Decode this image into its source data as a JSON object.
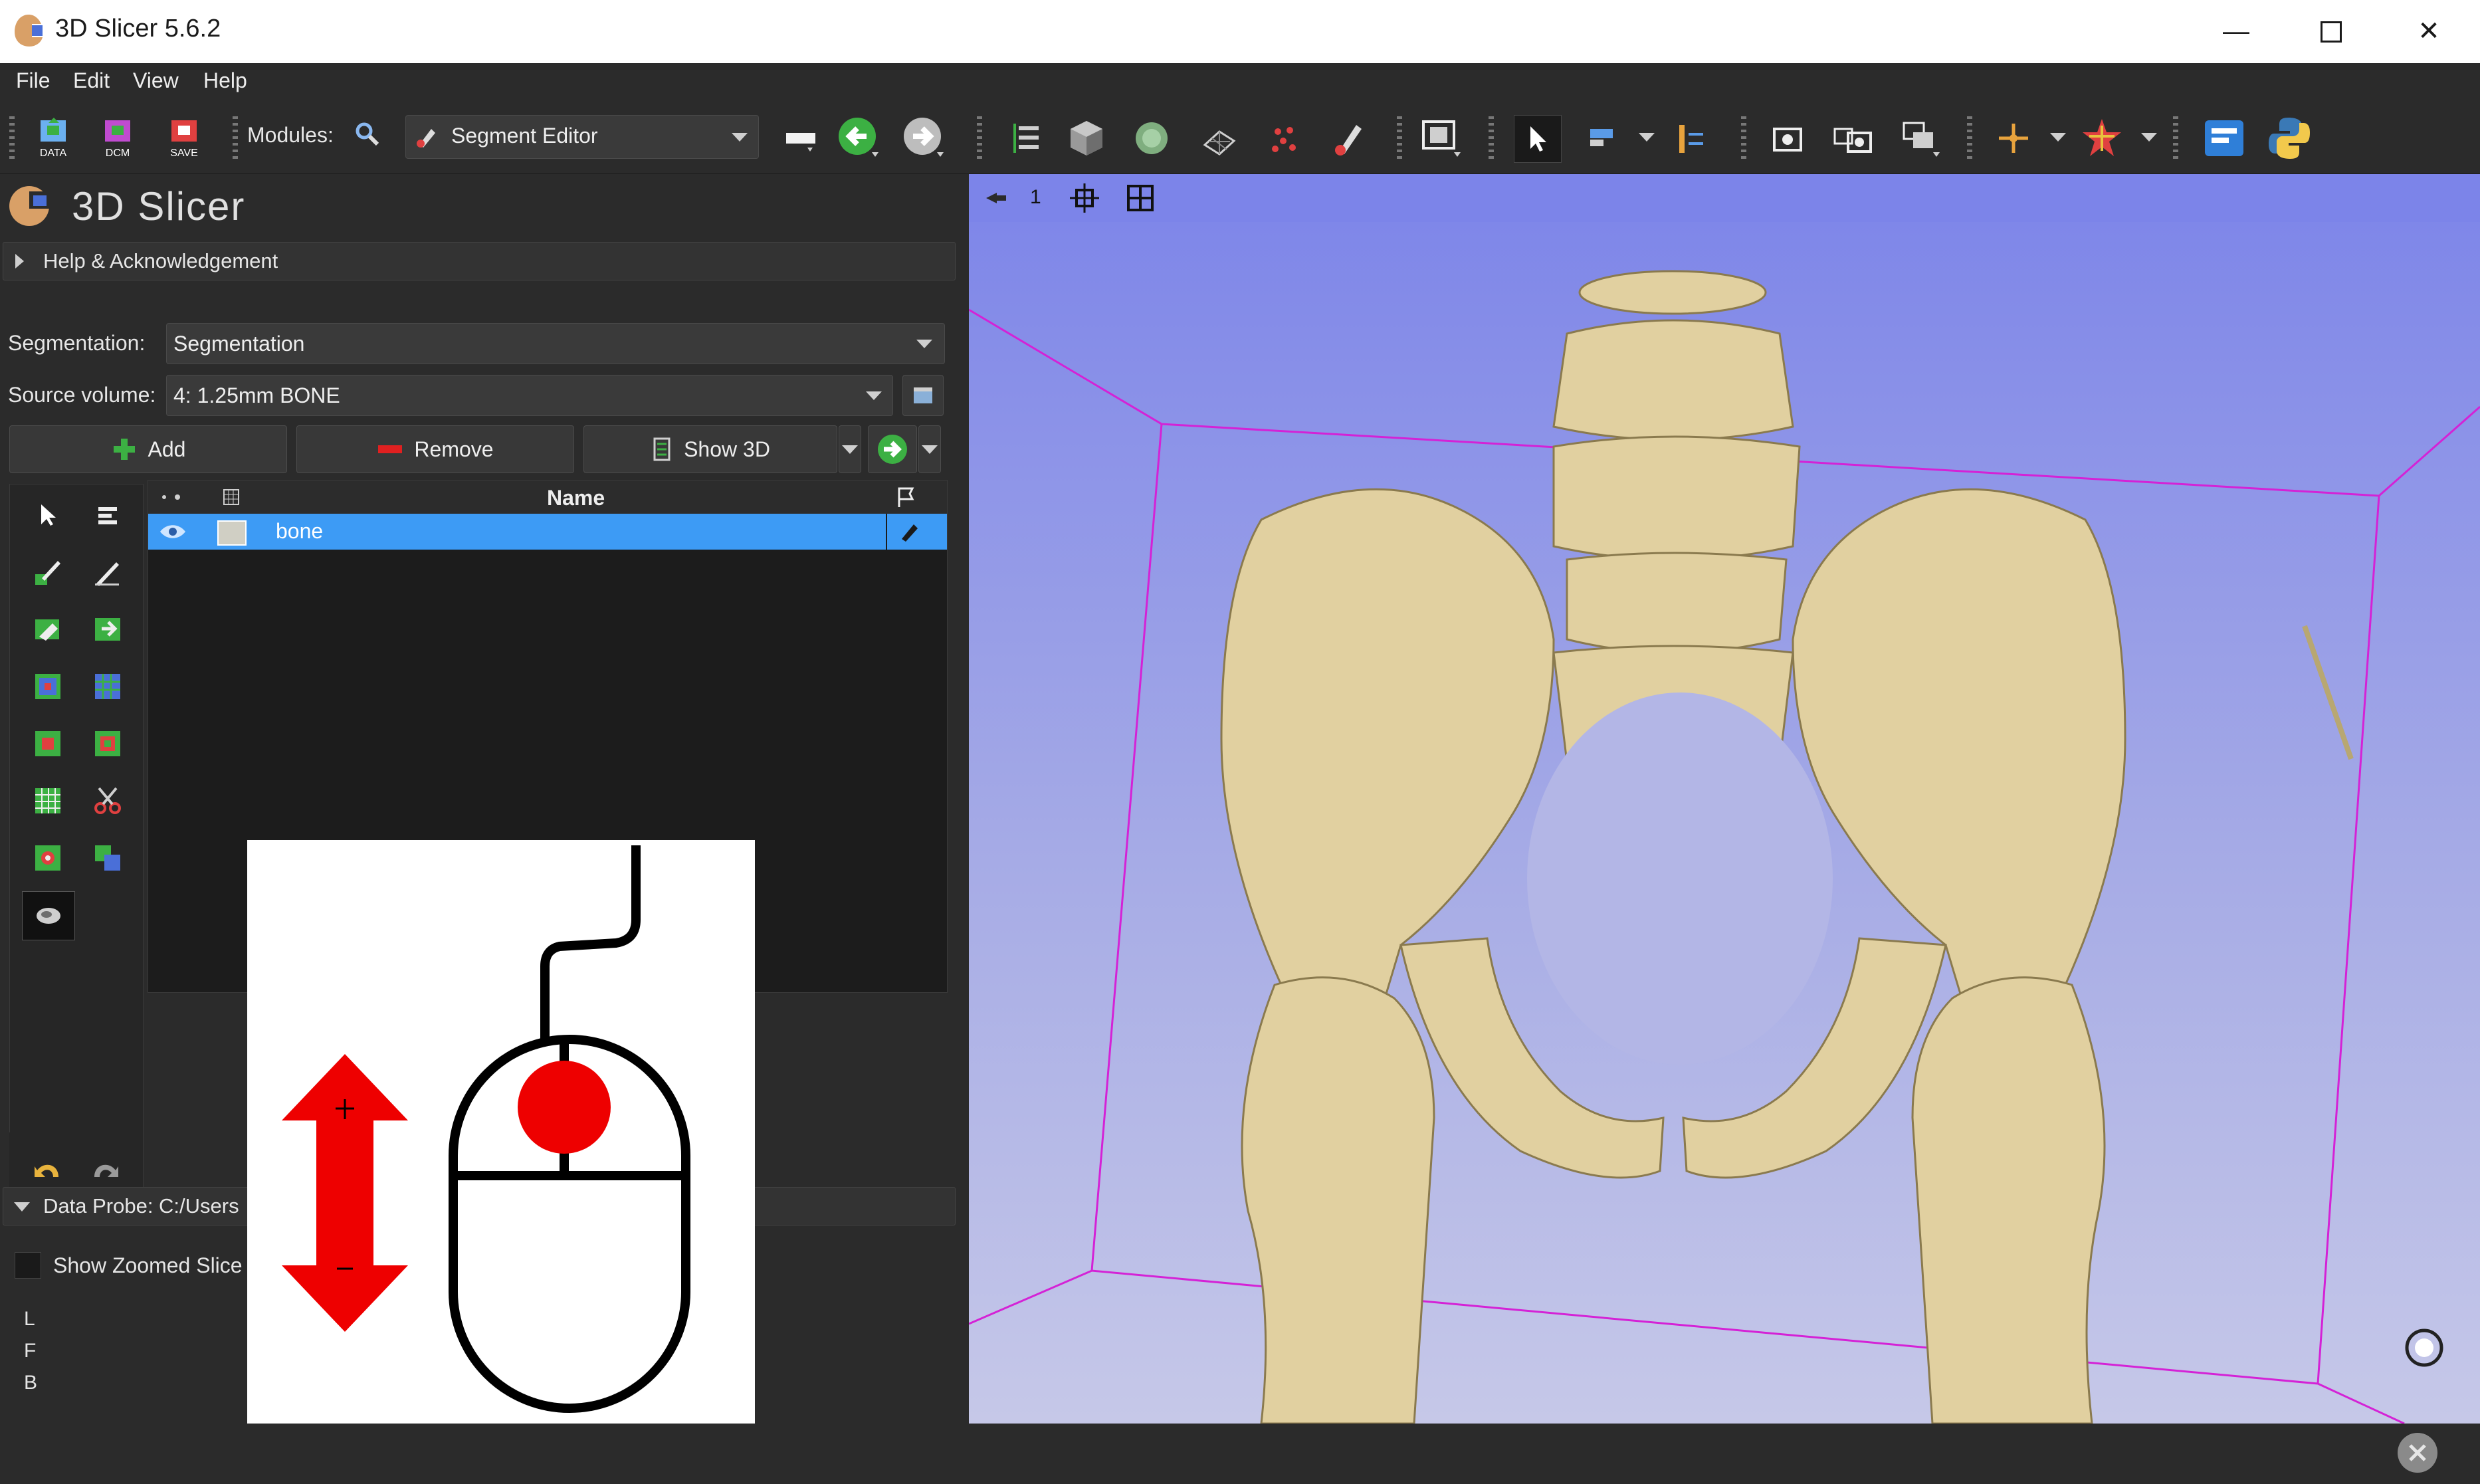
{
  "window": {
    "title": "3D Slicer 5.6.2",
    "controls": [
      "minimize-icon",
      "maximize-icon",
      "close-icon"
    ]
  },
  "menubar": {
    "items": [
      {
        "label": "File"
      },
      {
        "label": "Edit"
      },
      {
        "label": "View"
      },
      {
        "label": "Help"
      }
    ]
  },
  "toolbar": {
    "data_label": "DATA",
    "dcm_label": "DCM",
    "save_label": "SAVE",
    "modules_label": "Modules:",
    "module_selected": "Segment Editor"
  },
  "module_panel": {
    "logo_text": "3D Slicer",
    "help_section": "Help & Acknowledgement",
    "segmentation_label": "Segmentation:",
    "segmentation_value": "Segmentation",
    "source_volume_label": "Source volume:",
    "source_volume_value": "4: 1.25mm BONE",
    "add_label": "Add",
    "remove_label": "Remove",
    "show3d_label": "Show 3D",
    "table": {
      "name_header": "Name",
      "rows": [
        {
          "name": "bone",
          "color": "#e1d6a8",
          "visible": true,
          "selected": true
        }
      ]
    },
    "data_probe": {
      "label": "Data Probe: C:/Users",
      "show_zoomed_slice": "Show Zoomed Slice",
      "coords": [
        "L",
        "F",
        "B"
      ]
    }
  },
  "view3d": {
    "layout_number": "1",
    "background_top": "#7c84e9",
    "background_bottom": "#b9bde8",
    "bone_color": "#e1d0a0"
  },
  "colors": {
    "selection": "#3d9bf5",
    "accent_green": "#3cb043",
    "remove_red": "#e02020",
    "mouse_red": "#ee0000"
  }
}
